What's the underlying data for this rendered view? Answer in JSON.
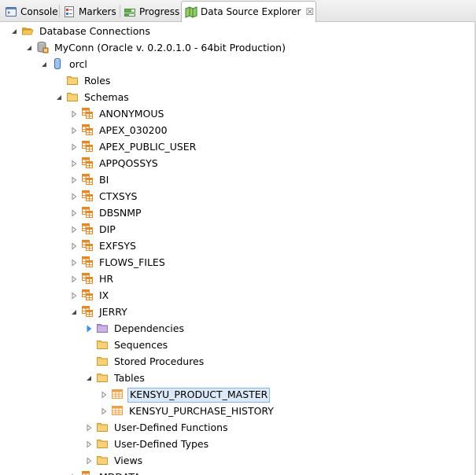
{
  "tabs": [
    {
      "label": "Console",
      "icon": "console-icon",
      "active": false
    },
    {
      "label": "Markers",
      "icon": "markers-icon",
      "active": false
    },
    {
      "label": "Progress",
      "icon": "progress-icon",
      "active": false
    },
    {
      "label": "Data Source Explorer",
      "icon": "data-source-explorer-icon",
      "active": true,
      "close": "☒"
    }
  ],
  "tree": [
    {
      "label": "Database Connections",
      "icon": "folder-open-icon",
      "twisty": "expanded",
      "level": 0
    },
    {
      "label": "MyConn (Oracle v. 0.2.0.1.0 - 64bit Production)",
      "icon": "connection-icon",
      "twisty": "expanded",
      "level": 1
    },
    {
      "label": "orcl",
      "icon": "database-icon",
      "twisty": "expanded",
      "level": 2
    },
    {
      "label": "Roles",
      "icon": "folder-icon",
      "twisty": "none",
      "level": 3
    },
    {
      "label": "Schemas",
      "icon": "folder-icon",
      "twisty": "expanded",
      "level": 3
    },
    {
      "label": "ANONYMOUS",
      "icon": "schema-icon",
      "twisty": "collapsed",
      "level": 4
    },
    {
      "label": "APEX_030200",
      "icon": "schema-icon",
      "twisty": "collapsed",
      "level": 4
    },
    {
      "label": "APEX_PUBLIC_USER",
      "icon": "schema-icon",
      "twisty": "collapsed",
      "level": 4
    },
    {
      "label": "APPQOSSYS",
      "icon": "schema-icon",
      "twisty": "collapsed",
      "level": 4
    },
    {
      "label": "BI",
      "icon": "schema-icon",
      "twisty": "collapsed",
      "level": 4
    },
    {
      "label": "CTXSYS",
      "icon": "schema-icon",
      "twisty": "collapsed",
      "level": 4
    },
    {
      "label": "DBSNMP",
      "icon": "schema-icon",
      "twisty": "collapsed",
      "level": 4
    },
    {
      "label": "DIP",
      "icon": "schema-icon",
      "twisty": "collapsed",
      "level": 4
    },
    {
      "label": "EXFSYS",
      "icon": "schema-icon",
      "twisty": "collapsed",
      "level": 4
    },
    {
      "label": "FLOWS_FILES",
      "icon": "schema-icon",
      "twisty": "collapsed",
      "level": 4
    },
    {
      "label": "HR",
      "icon": "schema-icon",
      "twisty": "collapsed",
      "level": 4
    },
    {
      "label": "IX",
      "icon": "schema-icon",
      "twisty": "collapsed",
      "level": 4
    },
    {
      "label": "JERRY",
      "icon": "schema-icon",
      "twisty": "expanded",
      "level": 4
    },
    {
      "label": "Dependencies",
      "icon": "folder-purple-icon",
      "twisty": "collapsed-blue",
      "level": 5
    },
    {
      "label": "Sequences",
      "icon": "folder-icon",
      "twisty": "none",
      "level": 5
    },
    {
      "label": "Stored Procedures",
      "icon": "folder-icon",
      "twisty": "none",
      "level": 5
    },
    {
      "label": "Tables",
      "icon": "folder-icon",
      "twisty": "expanded",
      "level": 5
    },
    {
      "label": "KENSYU_PRODUCT_MASTER",
      "icon": "table-icon",
      "twisty": "collapsed",
      "level": 6,
      "selected": true
    },
    {
      "label": "KENSYU_PURCHASE_HISTORY",
      "icon": "table-icon",
      "twisty": "collapsed",
      "level": 6
    },
    {
      "label": "User-Defined Functions",
      "icon": "folder-icon",
      "twisty": "collapsed",
      "level": 5
    },
    {
      "label": "User-Defined Types",
      "icon": "folder-icon",
      "twisty": "collapsed",
      "level": 5
    },
    {
      "label": "Views",
      "icon": "folder-icon",
      "twisty": "collapsed",
      "level": 5
    },
    {
      "label": "MDDATA",
      "icon": "schema-icon",
      "twisty": "collapsed",
      "level": 4
    }
  ],
  "colors": {
    "folder": "#f3c55a",
    "folder_dark": "#d9a235",
    "folder_purple": "#b99ad8",
    "schema_orange": "#e08a2c",
    "table_orange": "#e9a04a",
    "twisty_blue": "#3a8ee6",
    "selection_bg": "#dae8f8"
  }
}
